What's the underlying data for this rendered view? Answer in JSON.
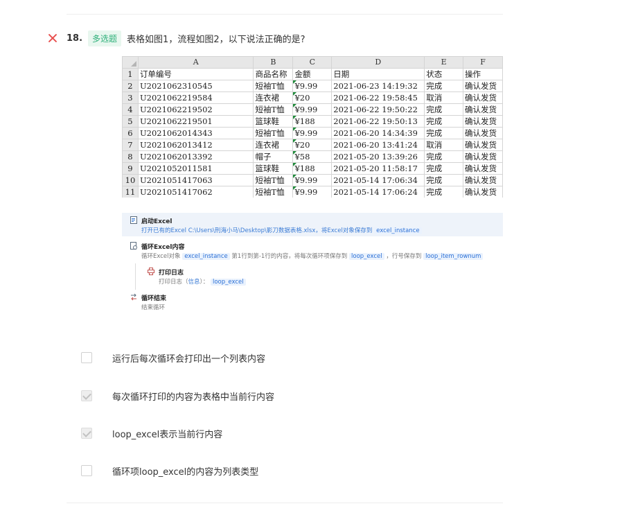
{
  "question": {
    "number": "18.",
    "type_badge": "多选题",
    "text": "表格如图1，流程如图2，以下说法正确的是?",
    "result_icon": "wrong-x-icon"
  },
  "sheet": {
    "columns": [
      "A",
      "B",
      "C",
      "D",
      "E",
      "F"
    ],
    "rows": [
      {
        "n": "1",
        "cells": [
          "订单编号",
          "商品名称",
          "金额",
          "日期",
          "状态",
          "操作"
        ]
      },
      {
        "n": "2",
        "cells": [
          "U2021062310545",
          "短袖T恤",
          "¥9.99",
          "2021-06-23 14:19:32",
          "完成",
          "确认发货"
        ]
      },
      {
        "n": "3",
        "cells": [
          "U2021062219584",
          "连衣裙",
          "¥20",
          "2021-06-22 19:58:45",
          "取消",
          "确认发货"
        ]
      },
      {
        "n": "4",
        "cells": [
          "U2021062219502",
          "短袖T恤",
          "¥9.99",
          "2021-06-22 19:50:22",
          "完成",
          "确认发货"
        ]
      },
      {
        "n": "5",
        "cells": [
          "U2021062219501",
          "篮球鞋",
          "¥188",
          "2021-06-22 19:50:13",
          "完成",
          "确认发货"
        ]
      },
      {
        "n": "6",
        "cells": [
          "U2021062014343",
          "短袖T恤",
          "¥9.99",
          "2021-06-20 14:34:39",
          "完成",
          "确认发货"
        ]
      },
      {
        "n": "7",
        "cells": [
          "U2021062013412",
          "连衣裙",
          "¥20",
          "2021-06-20 13:41:24",
          "取消",
          "确认发货"
        ]
      },
      {
        "n": "8",
        "cells": [
          "U2021062013392",
          "帽子",
          "¥58",
          "2021-05-20 13:39:26",
          "完成",
          "确认发货"
        ]
      },
      {
        "n": "9",
        "cells": [
          "U2021052011581",
          "篮球鞋",
          "¥188",
          "2021-05-20 11:58:17",
          "完成",
          "确认发货"
        ]
      },
      {
        "n": "10",
        "cells": [
          "U2021051417063",
          "短袖T恤",
          "¥9.99",
          "2021-05-14 17:06:34",
          "完成",
          "确认发货"
        ]
      },
      {
        "n": "11",
        "cells": [
          "U2021051417062",
          "短袖T恤",
          "¥9.99",
          "2021-05-14 17:06:24",
          "完成",
          "确认发货"
        ]
      }
    ]
  },
  "flow": {
    "steps": [
      {
        "title": "启动Excel",
        "desc_prefix": "打开已有的Excel C:\\Users\\刑海小马\\Desktop\\影刀数据表格.xlsx，将Excel对象保存到",
        "var": "excel_instance"
      },
      {
        "title": "循环Excel内容",
        "desc_prefix": "循环Excel对象",
        "var1": "excel_instance",
        "desc_mid": "第1行到第-1行的内容，将每次循环项保存到",
        "var2": "loop_excel",
        "desc_mid2": "，行号保存到",
        "var3": "loop_item_rownum"
      },
      {
        "title": "打印日志",
        "desc_prefix": "打印日志（",
        "desc_level": "信息",
        "desc_suffix": "）：",
        "var": "loop_excel"
      },
      {
        "title": "循环结束",
        "desc": "结束循环"
      }
    ]
  },
  "options": [
    {
      "label": "运行后每次循环会打印出一个列表内容",
      "checked": false
    },
    {
      "label": "每次循环打印的内容为表格中当前行内容",
      "checked": true
    },
    {
      "label": "loop_excel表示当前行内容",
      "checked": true
    },
    {
      "label": "循环项loop_excel的内容为列表类型",
      "checked": false
    }
  ]
}
